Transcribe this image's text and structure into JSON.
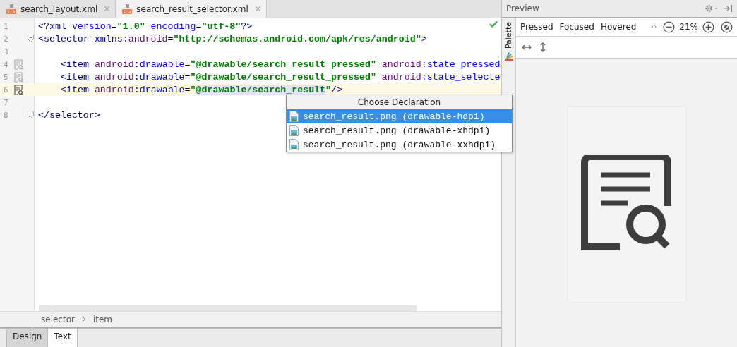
{
  "editor_tabs": [
    {
      "label": "search_layout.xml",
      "selected": false
    },
    {
      "label": "search_result_selector.xml",
      "selected": true
    }
  ],
  "code_lines": [
    {
      "number": "1",
      "fold": false,
      "gutter_icon": false,
      "current": false,
      "indented": false,
      "tokens": [
        {
          "t": "<?xml",
          "kind": "tag"
        },
        {
          "t": " version",
          "kind": "attr"
        },
        {
          "t": "=",
          "kind": "text"
        },
        {
          "t": "\"1.0\"",
          "kind": "value"
        },
        {
          "t": " encoding",
          "kind": "attr"
        },
        {
          "t": "=",
          "kind": "text"
        },
        {
          "t": "\"utf-8\"",
          "kind": "value"
        },
        {
          "t": "?>",
          "kind": "tag"
        }
      ]
    },
    {
      "number": "2",
      "fold": true,
      "gutter_icon": false,
      "current": false,
      "indented": false,
      "tokens": [
        {
          "t": "<selector",
          "kind": "tag"
        },
        {
          "t": " xmlns",
          "kind": "attr"
        },
        {
          "t": ":android",
          "kind": "ns"
        },
        {
          "t": "=",
          "kind": "text"
        },
        {
          "t": "\"http://schemas.android.com/apk/res/android\"",
          "kind": "value"
        },
        {
          "t": ">",
          "kind": "tag"
        }
      ]
    },
    {
      "number": "3",
      "fold": false,
      "gutter_icon": false,
      "current": false
    },
    {
      "number": "4",
      "fold": false,
      "gutter_icon": true,
      "current": false,
      "indented": true,
      "tokens": [
        {
          "t": "<item",
          "kind": "tag"
        },
        {
          "t": " android",
          "kind": "ns"
        },
        {
          "t": ":drawable",
          "kind": "attr"
        },
        {
          "t": "=",
          "kind": "text"
        },
        {
          "t": "\"@drawable/search_result_pressed\"",
          "kind": "value"
        },
        {
          "t": " android",
          "kind": "ns"
        },
        {
          "t": ":state_pressed",
          "kind": "attr"
        }
      ]
    },
    {
      "number": "5",
      "fold": false,
      "gutter_icon": true,
      "current": false,
      "indented": true,
      "tokens": [
        {
          "t": "<item",
          "kind": "tag"
        },
        {
          "t": " android",
          "kind": "ns"
        },
        {
          "t": ":drawable",
          "kind": "attr"
        },
        {
          "t": "=",
          "kind": "text"
        },
        {
          "t": "\"@drawable/search_result_pressed\"",
          "kind": "value"
        },
        {
          "t": " android",
          "kind": "ns"
        },
        {
          "t": ":state_selecte",
          "kind": "attr"
        }
      ]
    },
    {
      "number": "6",
      "fold": false,
      "gutter_icon": true,
      "current": true,
      "indented": true,
      "tokens": [
        {
          "t": "<item",
          "kind": "tag"
        },
        {
          "t": " android",
          "kind": "ns"
        },
        {
          "t": ":drawable",
          "kind": "attr"
        },
        {
          "t": "=",
          "kind": "text"
        },
        {
          "t": "\"",
          "kind": "value",
          "highlight": false
        },
        {
          "t": "@drawable/search_result",
          "kind": "value",
          "highlight": true
        },
        {
          "t": "\"",
          "kind": "value",
          "highlight": false
        },
        {
          "t": "/>",
          "kind": "tag"
        }
      ]
    },
    {
      "number": "7",
      "fold": false,
      "gutter_icon": false,
      "current": false
    },
    {
      "number": "8",
      "fold": true,
      "gutter_icon": false,
      "current": false,
      "indented": false,
      "tokens": [
        {
          "t": "</selector>",
          "kind": "tag"
        }
      ]
    }
  ],
  "popup": {
    "title": "Choose Declaration",
    "items": [
      {
        "label": "search_result.png (drawable-hdpi)",
        "selected": true
      },
      {
        "label": "search_result.png (drawable-xhdpi)",
        "selected": false
      },
      {
        "label": "search_result.png (drawable-xxhdpi)",
        "selected": false
      }
    ]
  },
  "breadcrumbs": [
    "selector",
    "item"
  ],
  "bottom_tabs": [
    {
      "label": "Design",
      "selected": false
    },
    {
      "label": "Text",
      "selected": true
    }
  ],
  "preview": {
    "title": "Preview",
    "side_tab": "Palette",
    "states": [
      "Pressed",
      "Focused",
      "Hovered"
    ],
    "zoom": "21%"
  }
}
